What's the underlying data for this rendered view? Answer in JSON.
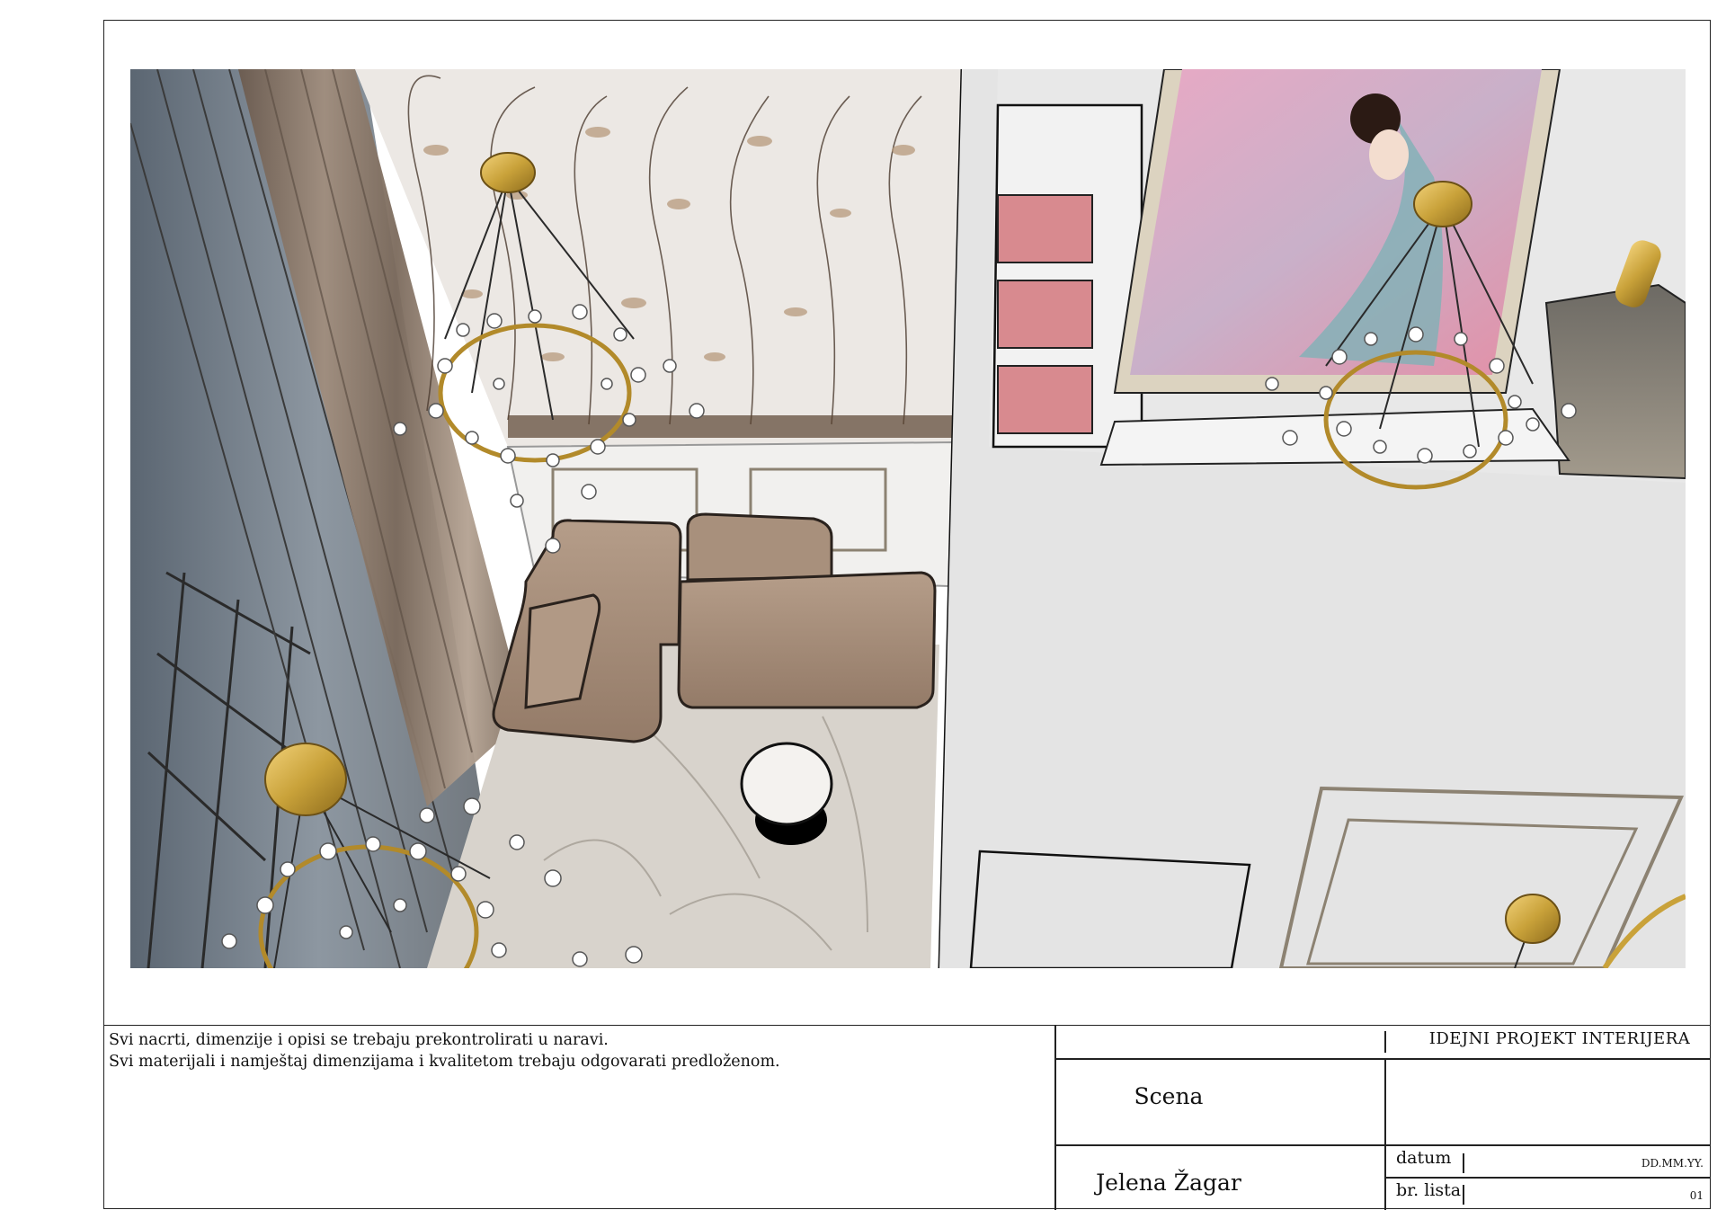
{
  "notes": {
    "line1": "Svi nacrti, dimenzije i opisi se trebaju prekontrolirati u naravi.",
    "line2": "Svi materijali i namještaj dimenzijama i kvalitetom trebaju odgovarati predloženom."
  },
  "title_block": {
    "project_title": "IDEJNI PROJEKT INTERIJERA",
    "scene_label": "Scena",
    "author": "Jelena Žagar",
    "date_label": "datum",
    "date_value": "DD.MM.YY.",
    "sheet_label": "br. lista",
    "sheet_value": "01"
  },
  "render": {
    "subject": "interior-render-top-view",
    "colors": {
      "sofa": "#a68e7c",
      "wall": "#e3e3e3",
      "gold": "#c9a23a",
      "shelf_pink": "#d88a8f",
      "curtain": "#8f7c6c",
      "floor": "#d8d3cc"
    }
  }
}
